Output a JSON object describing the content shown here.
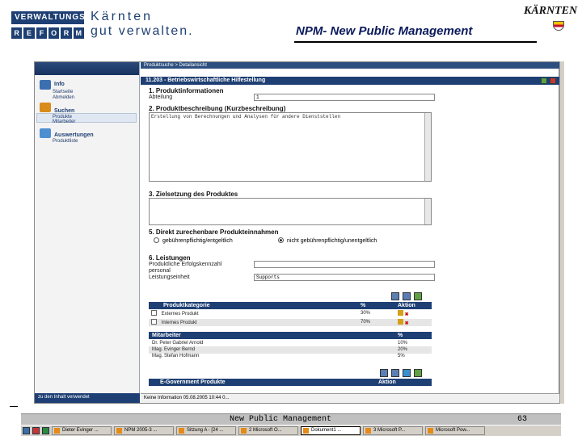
{
  "slide": {
    "logo_line1": "VERWALTUNGS",
    "logo_line2": [
      "R",
      "E",
      "F",
      "O",
      "R",
      "M"
    ],
    "logo_kaernten": "Kärnten",
    "logo_gut": "gut verwalten.",
    "title": "NPM- New Public Management",
    "kaernten_logo": "KÄRNTEN",
    "footer_text": "New Public Management",
    "page_number": "63"
  },
  "app": {
    "nav": {
      "sections": [
        {
          "label": "Info",
          "items": [
            "Startseite",
            "Abmelden"
          ]
        },
        {
          "label": "Suchen",
          "items": [
            "Produkte",
            "Mitarbeiter"
          ]
        },
        {
          "label": "Auswertungen",
          "items": [
            "Produktliste"
          ]
        }
      ],
      "bottom_label": "zu den Inhalt verwendet"
    },
    "topbar_text": "Produktsuche > Detailansicht",
    "title": "11.203 - Betriebswirtschaftliche Hilfestellung",
    "section1": {
      "title": "1. Produktinformationen",
      "field_label": "Abteilung",
      "field_value": "1"
    },
    "section2": {
      "title": "2. Produktbeschreibung (Kurzbeschreibung)",
      "text": "Erstellung von Berechnungen und Analysen für andere Dienststellen"
    },
    "section3": {
      "title": "3. Zielsetzung des Produktes"
    },
    "section5": {
      "title": "5. Direkt zurechenbare Produkteinnahmen",
      "option1": "gebührenpflichtig/entgeltlich",
      "option2": "nicht gebührenpflichtig/unentgeltlich",
      "selected": "option2"
    },
    "section6": {
      "title": "6. Leistungen",
      "label1": "Produktliche Erfolgskennzahl",
      "label1b": "personal",
      "label2": "Leistungseinheit",
      "value2": "Supports"
    },
    "kategorie_table": {
      "headers": [
        "Produktkategorie",
        "%",
        "Aktion"
      ],
      "rows": [
        {
          "name": "Externes Produkt",
          "pct": "30%"
        },
        {
          "name": "Internes Produkt",
          "pct": "70%"
        }
      ]
    },
    "mitarbeiter_table": {
      "headers": [
        "Mitarbeiter",
        "%"
      ],
      "rows": [
        {
          "name": "Dr. Peter Gabriel Arnold",
          "pct": "10%"
        },
        {
          "name": "Mag. Evinger Bernd",
          "pct": "20%"
        },
        {
          "name": "Mag. Stefan Hofmann",
          "pct": "5%"
        }
      ]
    },
    "egov_table": {
      "headers": [
        "E-Government Produkte",
        "Aktion"
      ]
    },
    "statusbar": "Keine Information  05.08.2005 10:44 0..."
  },
  "taskbar": {
    "items": [
      "Dieter Evinger ...",
      "NPM 2005-3 ...",
      "Sitzung A - [24 ...",
      "2 Microsoft O...",
      "Dokument1 ...",
      "3 Microsoft P...",
      "Microsoft Pow..."
    ],
    "active_index": 4
  },
  "colors": {
    "navy": "#1e3f73",
    "title_blue": "#0b1a5c",
    "panel_grey": "#f3f3f3"
  }
}
